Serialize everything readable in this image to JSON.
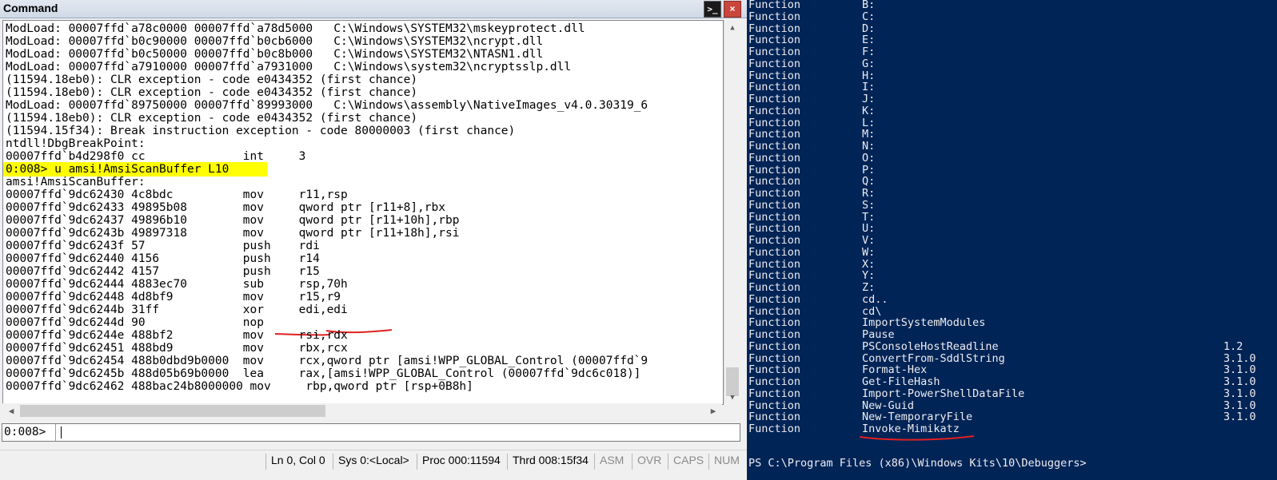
{
  "windbg": {
    "title": "Command",
    "cmd_icon": ">_",
    "close_icon": "×",
    "output_lines": [
      "ModLoad: 00007ffd`a78c0000 00007ffd`a78d5000   C:\\Windows\\SYSTEM32\\mskeyprotect.dll",
      "ModLoad: 00007ffd`b0c90000 00007ffd`b0cb6000   C:\\Windows\\SYSTEM32\\ncrypt.dll",
      "ModLoad: 00007ffd`b0c50000 00007ffd`b0c8b000   C:\\Windows\\SYSTEM32\\NTASN1.dll",
      "ModLoad: 00007ffd`a7910000 00007ffd`a7931000   C:\\Windows\\system32\\ncryptsslp.dll",
      "(11594.18eb0): CLR exception - code e0434352 (first chance)",
      "(11594.18eb0): CLR exception - code e0434352 (first chance)",
      "ModLoad: 00007ffd`89750000 00007ffd`89993000   C:\\Windows\\assembly\\NativeImages_v4.0.30319_6",
      "(11594.18eb0): CLR exception - code e0434352 (first chance)",
      "(11594.15f34): Break instruction exception - code 80000003 (first chance)",
      "ntdll!DbgBreakPoint:",
      "00007ffd`b4d298f0 cc              int     3",
      "0:008> u amsi!AmsiScanBuffer L10",
      "amsi!AmsiScanBuffer:",
      "00007ffd`9dc62430 4c8bdc          mov     r11,rsp",
      "00007ffd`9dc62433 49895b08        mov     qword ptr [r11+8],rbx",
      "00007ffd`9dc62437 49896b10        mov     qword ptr [r11+10h],rbp",
      "00007ffd`9dc6243b 49897318        mov     qword ptr [r11+18h],rsi",
      "00007ffd`9dc6243f 57              push    rdi",
      "00007ffd`9dc62440 4156            push    r14",
      "00007ffd`9dc62442 4157            push    r15",
      "00007ffd`9dc62444 4883ec70        sub     rsp,70h",
      "00007ffd`9dc62448 4d8bf9          mov     r15,r9",
      "00007ffd`9dc6244b 31ff            xor     edi,edi",
      "00007ffd`9dc6244d 90              nop",
      "00007ffd`9dc6244e 488bf2          mov     rsi,rdx",
      "00007ffd`9dc62451 488bd9          mov     rbx,rcx",
      "00007ffd`9dc62454 488b0dbd9b0000  mov     rcx,qword ptr [amsi!WPP_GLOBAL_Control (00007ffd`9",
      "00007ffd`9dc6245b 488d05b69b0000  lea     rax,[amsi!WPP_GLOBAL_Control (00007ffd`9dc6c018)]",
      "00007ffd`9dc62462 488bac24b8000000 mov     rbp,qword ptr [rsp+0B8h]"
    ],
    "prompt": "0:008>",
    "input_value": "",
    "status": {
      "position": "Ln 0, Col 0",
      "sys": "Sys 0:<Local>",
      "proc": "Proc 000:11594",
      "thrd": "Thrd 008:15f34",
      "asm": "ASM",
      "ovr": "OVR",
      "caps": "CAPS",
      "num": "NUM"
    }
  },
  "powershell": {
    "rows": [
      {
        "type": "Function",
        "name": "B:",
        "version": ""
      },
      {
        "type": "Function",
        "name": "C:",
        "version": ""
      },
      {
        "type": "Function",
        "name": "D:",
        "version": ""
      },
      {
        "type": "Function",
        "name": "E:",
        "version": ""
      },
      {
        "type": "Function",
        "name": "F:",
        "version": ""
      },
      {
        "type": "Function",
        "name": "G:",
        "version": ""
      },
      {
        "type": "Function",
        "name": "H:",
        "version": ""
      },
      {
        "type": "Function",
        "name": "I:",
        "version": ""
      },
      {
        "type": "Function",
        "name": "J:",
        "version": ""
      },
      {
        "type": "Function",
        "name": "K:",
        "version": ""
      },
      {
        "type": "Function",
        "name": "L:",
        "version": ""
      },
      {
        "type": "Function",
        "name": "M:",
        "version": ""
      },
      {
        "type": "Function",
        "name": "N:",
        "version": ""
      },
      {
        "type": "Function",
        "name": "O:",
        "version": ""
      },
      {
        "type": "Function",
        "name": "P:",
        "version": ""
      },
      {
        "type": "Function",
        "name": "Q:",
        "version": ""
      },
      {
        "type": "Function",
        "name": "R:",
        "version": ""
      },
      {
        "type": "Function",
        "name": "S:",
        "version": ""
      },
      {
        "type": "Function",
        "name": "T:",
        "version": ""
      },
      {
        "type": "Function",
        "name": "U:",
        "version": ""
      },
      {
        "type": "Function",
        "name": "V:",
        "version": ""
      },
      {
        "type": "Function",
        "name": "W:",
        "version": ""
      },
      {
        "type": "Function",
        "name": "X:",
        "version": ""
      },
      {
        "type": "Function",
        "name": "Y:",
        "version": ""
      },
      {
        "type": "Function",
        "name": "Z:",
        "version": ""
      },
      {
        "type": "Function",
        "name": "cd..",
        "version": ""
      },
      {
        "type": "Function",
        "name": "cd\\",
        "version": ""
      },
      {
        "type": "Function",
        "name": "ImportSystemModules",
        "version": ""
      },
      {
        "type": "Function",
        "name": "Pause",
        "version": ""
      },
      {
        "type": "Function",
        "name": "PSConsoleHostReadline",
        "version": "1.2"
      },
      {
        "type": "Function",
        "name": "ConvertFrom-SddlString",
        "version": "3.1.0"
      },
      {
        "type": "Function",
        "name": "Format-Hex",
        "version": "3.1.0"
      },
      {
        "type": "Function",
        "name": "Get-FileHash",
        "version": "3.1.0"
      },
      {
        "type": "Function",
        "name": "Import-PowerShellDataFile",
        "version": "3.1.0"
      },
      {
        "type": "Function",
        "name": "New-Guid",
        "version": "3.1.0"
      },
      {
        "type": "Function",
        "name": "New-TemporaryFile",
        "version": "3.1.0"
      },
      {
        "type": "Function",
        "name": "Invoke-Mimikatz",
        "version": ""
      }
    ],
    "prompt": "PS C:\\Program Files (x86)\\Windows Kits\\10\\Debuggers>"
  },
  "colors": {
    "ps_background": "#012456",
    "highlight": "#ffff00",
    "annotation_red": "#e02020"
  }
}
